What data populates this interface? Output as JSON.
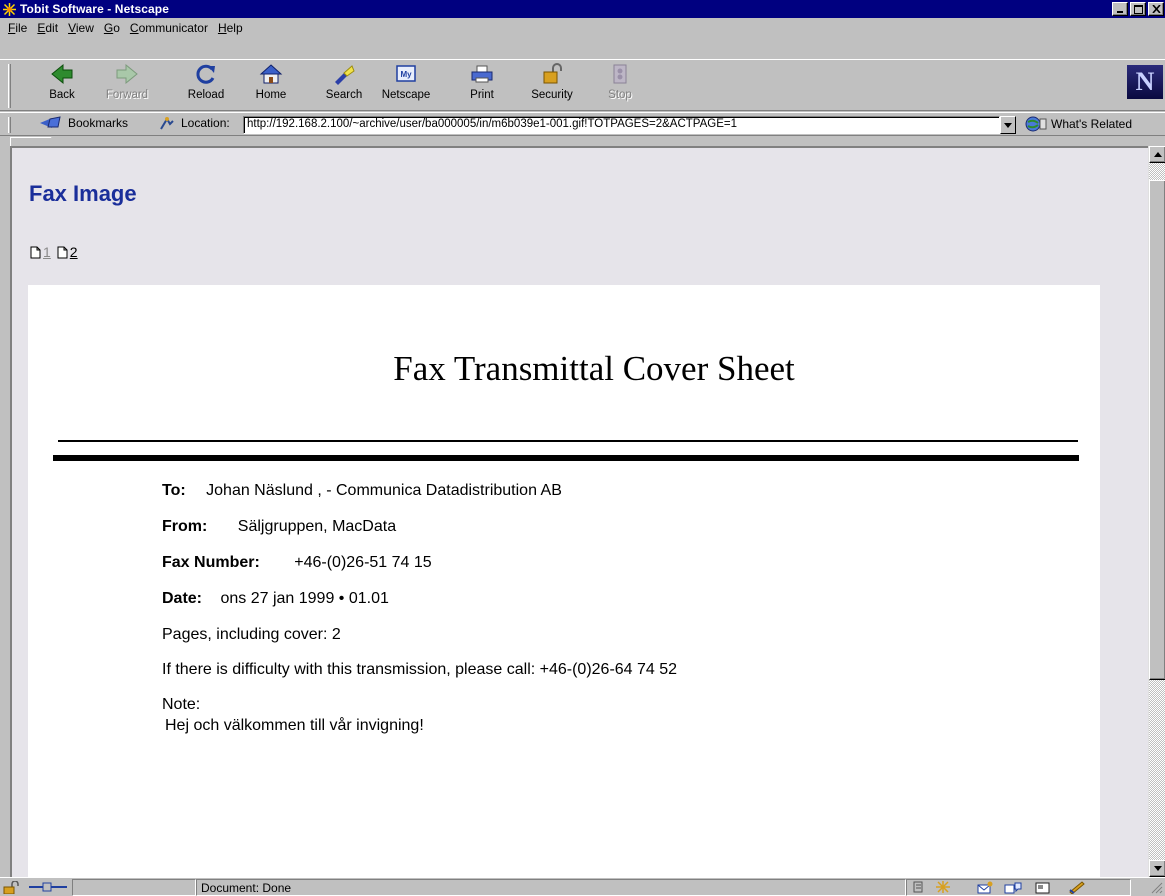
{
  "window": {
    "title": "Tobit Software - Netscape",
    "controls": [
      "minimize",
      "maximize",
      "close"
    ]
  },
  "menubar": {
    "items": [
      {
        "label": "File",
        "accel": "F"
      },
      {
        "label": "Edit",
        "accel": "E"
      },
      {
        "label": "View",
        "accel": "V"
      },
      {
        "label": "Go",
        "accel": "G"
      },
      {
        "label": "Communicator",
        "accel": "C"
      },
      {
        "label": "Help",
        "accel": "H"
      }
    ]
  },
  "toolbar": {
    "buttons": [
      {
        "label": "Back",
        "icon": "back-arrow-icon",
        "enabled": true
      },
      {
        "label": "Forward",
        "icon": "forward-arrow-icon",
        "enabled": false
      },
      {
        "label": "Reload",
        "icon": "reload-icon",
        "enabled": true
      },
      {
        "label": "Home",
        "icon": "home-icon",
        "enabled": true
      },
      {
        "label": "Search",
        "icon": "search-flashlight-icon",
        "enabled": true
      },
      {
        "label": "Netscape",
        "icon": "my-netscape-icon",
        "enabled": true
      },
      {
        "label": "Print",
        "icon": "printer-icon",
        "enabled": true
      },
      {
        "label": "Security",
        "icon": "padlock-icon",
        "enabled": true
      },
      {
        "label": "Stop",
        "icon": "stop-icon",
        "enabled": false
      }
    ],
    "logo_letter": "N"
  },
  "location_bar": {
    "bookmarks_label": "Bookmarks",
    "location_label": "Location:",
    "url": "http://192.168.2.100/~archive/user/ba000005/in/m6b039e1-001.gif!TOTPAGES=2&ACTPAGE=1",
    "whats_related_label": "What's Related"
  },
  "page": {
    "heading": "Fax Image",
    "pages": [
      {
        "number": "1",
        "current": true
      },
      {
        "number": "2",
        "current": false
      }
    ]
  },
  "fax": {
    "title": "Fax Transmittal Cover Sheet",
    "to_label": "To:",
    "to_value": "Johan Näslund ,  - Communica Datadistribution AB",
    "from_label": "From:",
    "from_value": "Säljgruppen, MacData",
    "fax_label": "Fax Number:",
    "fax_value": "+46-(0)26-51 74 15",
    "date_label": "Date:",
    "date_value": "ons 27 jan 1999 • 01.01",
    "pages_text": "Pages, including cover: 2",
    "difficulty_text": "If there is difficulty with this transmission, please call: +46-(0)26-64 74 52",
    "note_label": "Note:",
    "note_text": "Hej och välkommen till vår invigning!"
  },
  "statusbar": {
    "text": "Document: Done"
  },
  "colors": {
    "titlebar": "#000080",
    "heading": "#1a2e9a",
    "chrome": "#c0c0c0",
    "content_bg": "#e6e4ea"
  }
}
